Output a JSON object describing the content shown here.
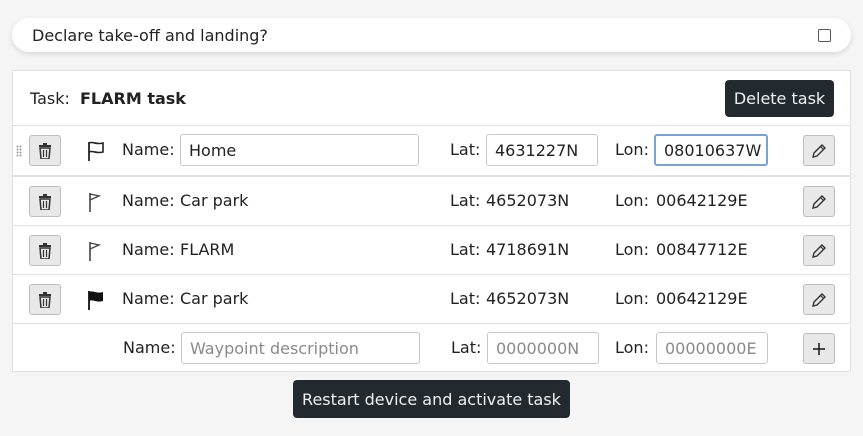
{
  "declare": {
    "label": "Declare take-off and landing?",
    "checked": false
  },
  "task": {
    "label": "Task:",
    "name": "FLARM task",
    "delete_label": "Delete task"
  },
  "field_labels": {
    "name": "Name:",
    "lat": "Lat:",
    "lon": "Lon:"
  },
  "waypoints": [
    {
      "name": "Home",
      "lat": "4631227N",
      "lon": "08010637W",
      "editing": true,
      "flag": "flag-outline-icon"
    },
    {
      "name": "Car park",
      "lat": "4652073N",
      "lon": "00642129E",
      "editing": false,
      "flag": "flag-small-icon"
    },
    {
      "name": "FLARM",
      "lat": "4718691N",
      "lon": "00847712E",
      "editing": false,
      "flag": "flag-small-icon"
    },
    {
      "name": "Car park",
      "lat": "4652073N",
      "lon": "00642129E",
      "editing": false,
      "flag": "flag-filled-icon"
    }
  ],
  "new_waypoint": {
    "name_placeholder": "Waypoint description",
    "lat_placeholder": "0000000N",
    "lon_placeholder": "00000000E"
  },
  "restart_label": "Restart device and activate task",
  "colors": {
    "dark_button": "#222a30",
    "focus": "#7aa2d8",
    "border": "#e2e2e2"
  }
}
